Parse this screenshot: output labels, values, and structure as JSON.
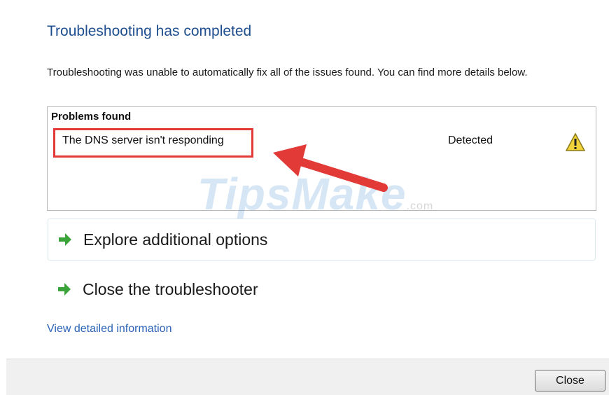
{
  "title": "Troubleshooting has completed",
  "description": "Troubleshooting was unable to automatically fix all of the issues found. You can find more details below.",
  "problems": {
    "header": "Problems found",
    "items": [
      {
        "name": "The DNS server isn't responding",
        "status": "Detected",
        "icon": "warning-icon"
      }
    ]
  },
  "watermark": {
    "brand": "TipsMake",
    "suffix": ".com"
  },
  "options": [
    {
      "label": "Explore additional options",
      "icon": "green-arrow-icon"
    },
    {
      "label": "Close the troubleshooter",
      "icon": "green-arrow-icon"
    }
  ],
  "view_detailed_link": "View detailed information",
  "footer": {
    "close_label": "Close"
  },
  "colors": {
    "title": "#1f4f8f",
    "link": "#2a63b8",
    "highlight": "#e23a36",
    "arrow_green": "#3aa33a",
    "warning_yellow": "#f2d23a"
  }
}
